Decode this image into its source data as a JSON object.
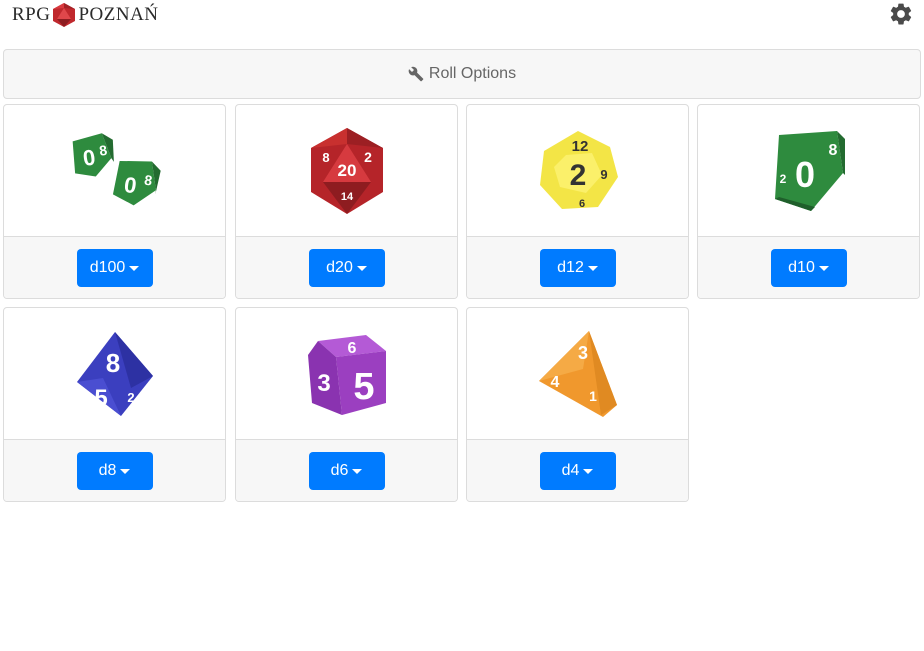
{
  "header": {
    "logo_left": "RPG",
    "logo_right": "POZNAŃ",
    "settings_icon": "gear-icon"
  },
  "options": {
    "label": "Roll Options",
    "icon": "wrench-icon"
  },
  "dice": [
    {
      "label": "d100",
      "icon": "d100-dice-icon",
      "color": "#2e8b3e"
    },
    {
      "label": "d20",
      "icon": "d20-dice-icon",
      "color": "#c0282d"
    },
    {
      "label": "d12",
      "icon": "d12-dice-icon",
      "color": "#f4e84a"
    },
    {
      "label": "d10",
      "icon": "d10-dice-icon",
      "color": "#2e8b3e"
    },
    {
      "label": "d8",
      "icon": "d8-dice-icon",
      "color": "#3b3fbf"
    },
    {
      "label": "d6",
      "icon": "d6-dice-icon",
      "color": "#9b3fc0"
    },
    {
      "label": "d4",
      "icon": "d4-dice-icon",
      "color": "#f0982d"
    }
  ],
  "colors": {
    "button": "#007bff",
    "card_footer": "#f7f7f7",
    "border": "#dcdcdc"
  }
}
